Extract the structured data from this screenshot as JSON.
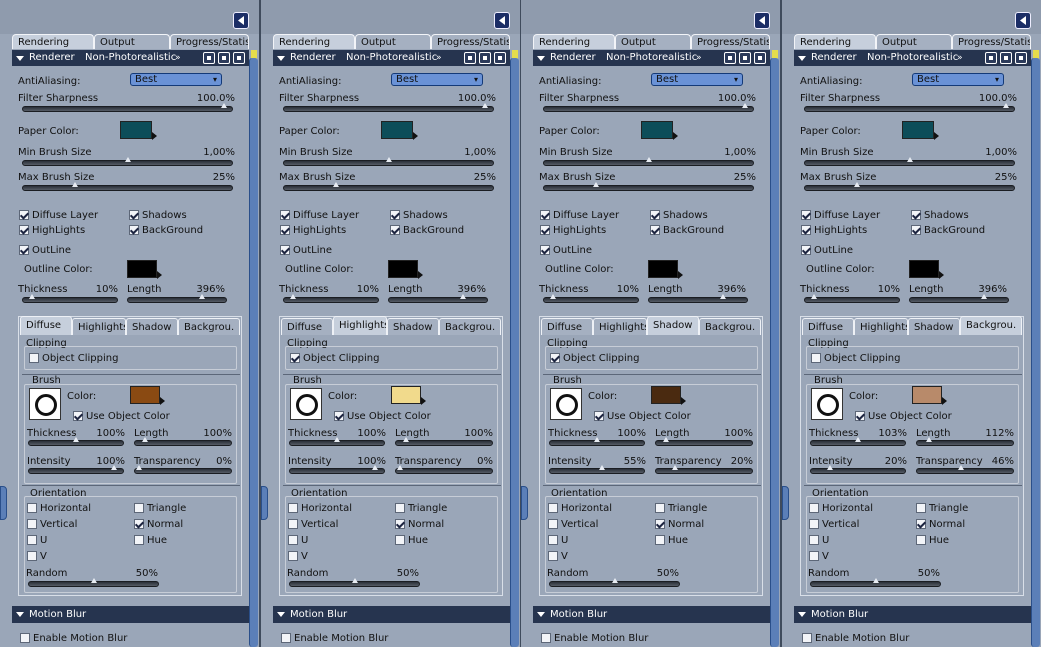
{
  "tabs": [
    "Rendering",
    "Output",
    "Progress/Statist."
  ],
  "renderer": {
    "label": "Renderer",
    "value": "Non-Photorealistic",
    "chevron": "»"
  },
  "labels": {
    "antialiasing": "AntiAliasing:",
    "filter_sharpness": "Filter Sharpness",
    "paper_color": "Paper Color:",
    "min_brush": "Min Brush Size",
    "max_brush": "Max Brush Size",
    "diffuse_layer": "Diffuse Layer",
    "shadows": "Shadows",
    "highlights": "HighLights",
    "background": "BackGround",
    "outline": "OutLine",
    "outline_color": "Outline Color:",
    "thickness": "Thickness",
    "length": "Length",
    "clipping": "Clipping",
    "object_clipping": "Object Clipping",
    "brush": "Brush",
    "color": "Color:",
    "use_object_color": "Use Object Color",
    "intensity": "Intensity",
    "transparency": "Transparency",
    "orientation": "Orientation",
    "horizontal": "Horizontal",
    "triangle": "Triangle",
    "vertical": "Vertical",
    "normal": "Normal",
    "u": "U",
    "hue": "Hue",
    "v": "V",
    "random": "Random",
    "motion_blur": "Motion Blur",
    "enable_motion_blur": "Enable Motion Blur"
  },
  "subtabs": [
    "Diffuse",
    "Highlights",
    "Shadow",
    "Backgrou."
  ],
  "colors": {
    "paper": "#0d4d59",
    "outline": "#000000",
    "accent": "#26344f"
  },
  "panels": [
    {
      "antialiasing": "Best",
      "filter_sharpness": {
        "text": "100.0%",
        "value": 1.0
      },
      "min_brush": {
        "text": "1,00%",
        "value": 0.5
      },
      "max_brush": {
        "text": "25%",
        "value": 0.25
      },
      "checks": {
        "diffuse_layer": true,
        "shadows": true,
        "highlights": true,
        "background": true,
        "outline": true
      },
      "outline_thickness": {
        "text": "10%",
        "value": 0.1
      },
      "outline_length": {
        "text": "396%",
        "value": 0.75
      },
      "active_subtab": 0,
      "object_clipping": false,
      "brush_color": "#8a4a12",
      "use_object_color": true,
      "brush_thickness": {
        "text": "100%",
        "value": 0.5
      },
      "brush_length": {
        "text": "100%",
        "value": 0.1
      },
      "intensity": {
        "text": "100%",
        "value": 0.9
      },
      "transparency": {
        "text": "0%",
        "value": 0.03
      },
      "orientation": {
        "horizontal": false,
        "triangle": false,
        "vertical": false,
        "normal": true,
        "u": false,
        "hue": false,
        "v": false
      },
      "random": {
        "text": "50%",
        "value": 0.5
      },
      "enable_motion_blur": false
    },
    {
      "antialiasing": "Best",
      "filter_sharpness": {
        "text": "100.0%",
        "value": 1.0
      },
      "min_brush": {
        "text": "1,00%",
        "value": 0.5
      },
      "max_brush": {
        "text": "25%",
        "value": 0.25
      },
      "checks": {
        "diffuse_layer": true,
        "shadows": true,
        "highlights": true,
        "background": true,
        "outline": true
      },
      "outline_thickness": {
        "text": "10%",
        "value": 0.1
      },
      "outline_length": {
        "text": "396%",
        "value": 0.75
      },
      "active_subtab": 1,
      "object_clipping": true,
      "brush_color": "#f1da8c",
      "use_object_color": true,
      "brush_thickness": {
        "text": "100%",
        "value": 0.5
      },
      "brush_length": {
        "text": "100%",
        "value": 0.1
      },
      "intensity": {
        "text": "100%",
        "value": 0.9
      },
      "transparency": {
        "text": "0%",
        "value": 0.03
      },
      "orientation": {
        "horizontal": false,
        "triangle": false,
        "vertical": false,
        "normal": true,
        "u": false,
        "hue": false,
        "v": false
      },
      "random": {
        "text": "50%",
        "value": 0.5
      },
      "enable_motion_blur": false
    },
    {
      "antialiasing": "Best",
      "filter_sharpness": {
        "text": "100.0%",
        "value": 1.0
      },
      "min_brush": {
        "text": "1,00%",
        "value": 0.5
      },
      "max_brush": {
        "text": "25%",
        "value": 0.25
      },
      "checks": {
        "diffuse_layer": true,
        "shadows": true,
        "highlights": true,
        "background": true,
        "outline": true
      },
      "outline_thickness": {
        "text": "10%",
        "value": 0.1
      },
      "outline_length": {
        "text": "396%",
        "value": 0.75
      },
      "active_subtab": 2,
      "object_clipping": true,
      "brush_color": "#4a2a10",
      "use_object_color": true,
      "brush_thickness": {
        "text": "100%",
        "value": 0.5
      },
      "brush_length": {
        "text": "100%",
        "value": 0.1
      },
      "intensity": {
        "text": "55%",
        "value": 0.55
      },
      "transparency": {
        "text": "20%",
        "value": 0.2
      },
      "orientation": {
        "horizontal": false,
        "triangle": false,
        "vertical": false,
        "normal": true,
        "u": false,
        "hue": false,
        "v": false
      },
      "random": {
        "text": "50%",
        "value": 0.5
      },
      "enable_motion_blur": false
    },
    {
      "antialiasing": "Best",
      "filter_sharpness": {
        "text": "100.0%",
        "value": 1.0
      },
      "min_brush": {
        "text": "1,00%",
        "value": 0.5
      },
      "max_brush": {
        "text": "25%",
        "value": 0.25
      },
      "checks": {
        "diffuse_layer": true,
        "shadows": true,
        "highlights": true,
        "background": true,
        "outline": true
      },
      "outline_thickness": {
        "text": "10%",
        "value": 0.1
      },
      "outline_length": {
        "text": "396%",
        "value": 0.75
      },
      "active_subtab": 3,
      "object_clipping": false,
      "brush_color": "#b88a6a",
      "use_object_color": true,
      "brush_thickness": {
        "text": "103%",
        "value": 0.5
      },
      "brush_length": {
        "text": "112%",
        "value": 0.12
      },
      "intensity": {
        "text": "20%",
        "value": 0.2
      },
      "transparency": {
        "text": "46%",
        "value": 0.46
      },
      "orientation": {
        "horizontal": false,
        "triangle": false,
        "vertical": false,
        "normal": true,
        "u": false,
        "hue": false,
        "v": false
      },
      "random": {
        "text": "50%",
        "value": 0.5
      },
      "enable_motion_blur": false
    }
  ]
}
